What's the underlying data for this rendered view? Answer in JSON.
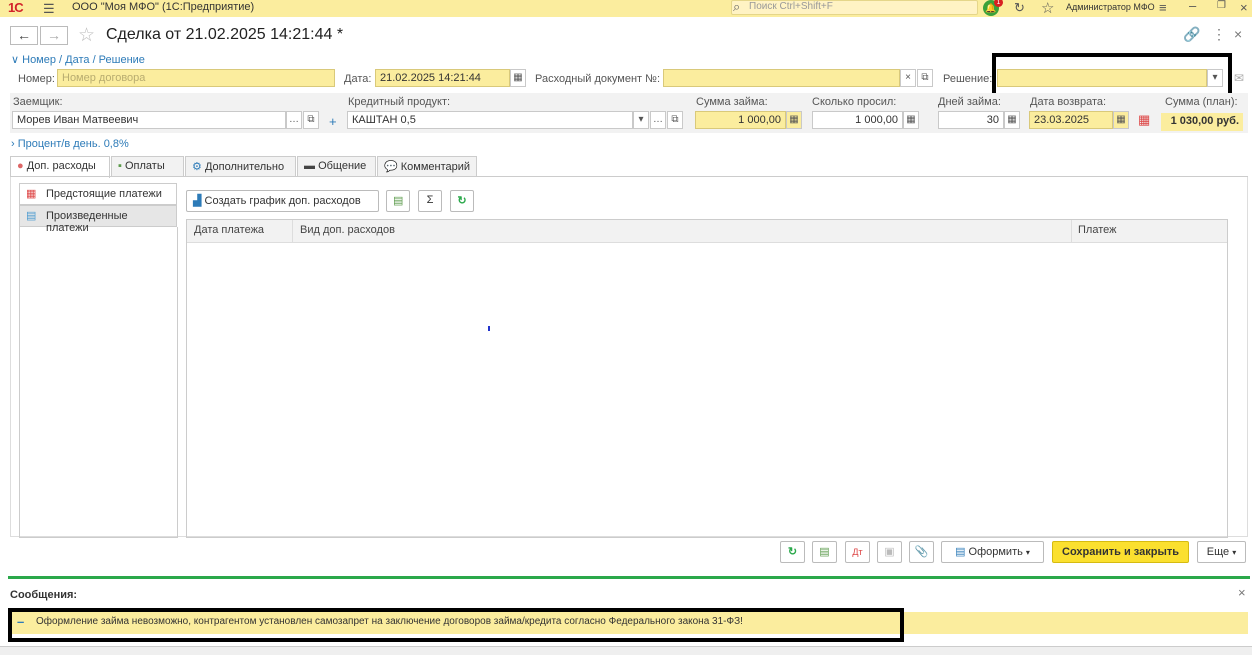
{
  "topbar": {
    "logo": "1С",
    "app_title": "ООО \"Моя МФО\"  (1С:Предприятие)",
    "search_placeholder": "Поиск Ctrl+Shift+F",
    "notification_count": "1",
    "user": "Администратор МФО"
  },
  "header": {
    "doc_title": "Сделка  от 21.02.2025 14:21:44 *"
  },
  "group": {
    "number_date_link": "Номер / Дата / Решение",
    "number_label": "Номер:",
    "number_placeholder": "Номер договора",
    "date_label": "Дата:",
    "date_value": "21.02.2025 14:21:44",
    "expense_doc_label": "Расходный документ №:",
    "expense_doc_value": "",
    "decision_label": "Решение:",
    "decision_value": ""
  },
  "loan": {
    "borrower_label": "Заемщик:",
    "borrower_value": "Морев Иван Матвеевич",
    "product_label": "Кредитный продукт:",
    "product_value": "КАШТАН 0,5",
    "amount_label": "Сумма займа:",
    "amount_value": "1 000,00",
    "requested_label": "Сколько просил:",
    "requested_value": "1 000,00",
    "days_label": "Дней займа:",
    "days_value": "30",
    "return_label": "Дата возврата:",
    "return_value": "23.03.2025",
    "plan_label": "Сумма (план):",
    "plan_value": "1 030,00 руб.",
    "percent_link": "Процент/в день. 0,8%"
  },
  "tabs": [
    {
      "label": "Доп. расходы"
    },
    {
      "label": "Оплаты"
    },
    {
      "label": "Дополнительно"
    },
    {
      "label": "Общение"
    },
    {
      "label": "Комментарий"
    }
  ],
  "side": {
    "upcoming": "Предстоящие платежи",
    "done": "Произведенные платежи"
  },
  "toolbar": {
    "create_schedule": "Создать график доп. расходов",
    "sigma": "Σ"
  },
  "grid": {
    "columns": [
      "Дата платежа",
      "Вид доп. расходов",
      "Платеж"
    ]
  },
  "bottom": {
    "print_label": "Оформить",
    "save_close": "Сохранить и закрыть",
    "more": "Еще"
  },
  "messages": {
    "title": "Сообщения:",
    "text": "Оформление займа невозможно, контрагентом установлен самозапрет на заключение договоров займа/кредита согласно Федерального закона 31-ФЗ!"
  },
  "colors": {
    "accent_yellow": "#fbed9e",
    "link_blue": "#2d7bb8",
    "save_yellow": "#fbe02f",
    "success_green": "#2aa84a"
  }
}
